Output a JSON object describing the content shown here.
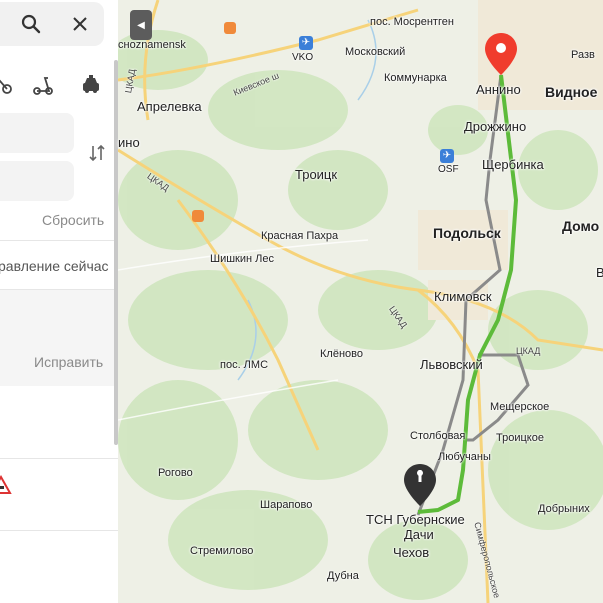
{
  "panel": {
    "reset_label": "Сбросить",
    "now_label": "равление сейчас",
    "fix_label": "Исправить"
  },
  "map": {
    "cities": {
      "mosrentgen": "пос. Мосрентген",
      "snoznamensk": "сноznamensk",
      "moskovsky": "Московский",
      "vko": "VKO",
      "kommunarka": "Коммунарка",
      "annino": "Аннино",
      "vidnoe": "Видное",
      "razv": "Разв",
      "aprelevka": "Апрелевка",
      "ino": "ино",
      "drozhzhino": "Дрожжино",
      "osf": "OSF",
      "shcherbinka": "Щербинка",
      "troitsk": "Троицк",
      "krasnaya_pakhra": "Красная Пахра",
      "podolsk": "Подольск",
      "domo": "Домо",
      "shishkin_les": "Шишкин Лес",
      "klimovsk": "Климовск",
      "klenovo": "Клёново",
      "lms": "пос. ЛМС",
      "lvovsky": "Львовский",
      "meshcherskoe": "Мещерское",
      "stolbovaya": "Столбовая",
      "troitskoe": "Троицкое",
      "lyubuchany": "Любучаны",
      "rogovo": "Рогово",
      "sharapovo": "Шарапово",
      "tsn": "ТСН Губернские",
      "dachi": "Дачи",
      "dobrynikha": "Добрыних",
      "chekhov": "Чехов",
      "stremilovo": "Стремилово",
      "dubna": "Дубна",
      "v": "В"
    },
    "roads": {
      "kievskoe": "Киевское ш",
      "ckad1": "ЦКАД",
      "ckad2": "ЦКАД",
      "ckad3": "ЦКАД",
      "ckad4": "ЦКАД",
      "simf": "Симферопольское"
    },
    "colors": {
      "route_main": "#5dbb3a",
      "route_alt": "#8a8a8a",
      "destination_pin": "#f03c2d",
      "origin_pin": "#333333"
    }
  }
}
